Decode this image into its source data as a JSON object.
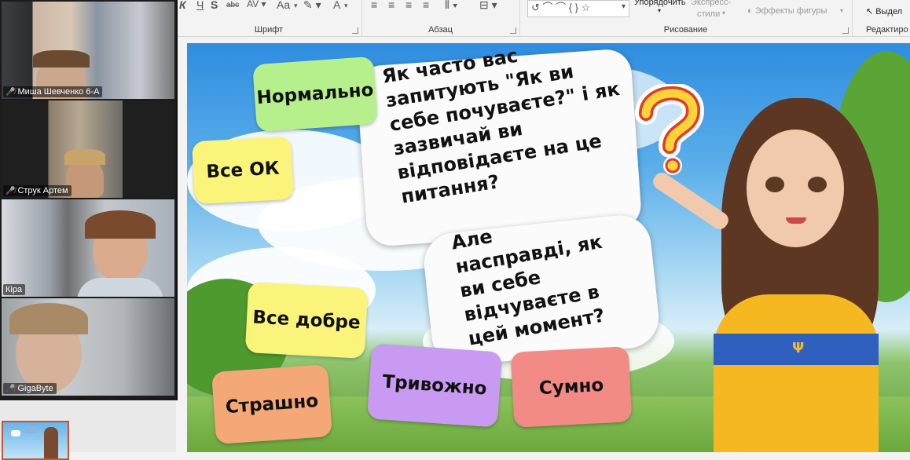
{
  "ribbon": {
    "font_group_label": "Шрифт",
    "paragraph_group_label": "Абзац",
    "drawing_group_label": "Рисование",
    "editing_group_label": "Редактиро",
    "arrange_label": "Упорядочить",
    "quick_styles_label_1": "Экспресс-",
    "quick_styles_label_2": "стили",
    "shape_effects_label": "Эффекты фигуры",
    "select_label": "Выдел",
    "aa_label": "Aa",
    "a_label": "A",
    "k_label": "К",
    "ch_label": "Ч",
    "abc_label": "abc"
  },
  "participants": [
    {
      "name": "Миша Шевченко 6-А",
      "muted": true
    },
    {
      "name": "Струк Артем",
      "muted": true
    },
    {
      "name": "Кіра",
      "muted": false
    },
    {
      "name": "GigaByte",
      "muted": true
    }
  ],
  "slide": {
    "question_text": "Як часто вас\nзапитують \"Як ви\nсебе почуваєте?\" і як\nзазвичай ви\nвідповідаєте на це\nпитання?",
    "followup_text": "Але\nнасправді, як\nви себе\nвідчуваєте в\nцей момент?",
    "answers": [
      {
        "label": "Нормально",
        "color": "#b6f08c"
      },
      {
        "label": "Все ОК",
        "color": "#fbf47a"
      },
      {
        "label": "Все добре",
        "color": "#fbf47a"
      },
      {
        "label": "Страшно",
        "color": "#f4a777"
      },
      {
        "label": "Тривожно",
        "color": "#c99af2"
      },
      {
        "label": "Сумно",
        "color": "#f28a86"
      }
    ],
    "question_mark": "?"
  }
}
